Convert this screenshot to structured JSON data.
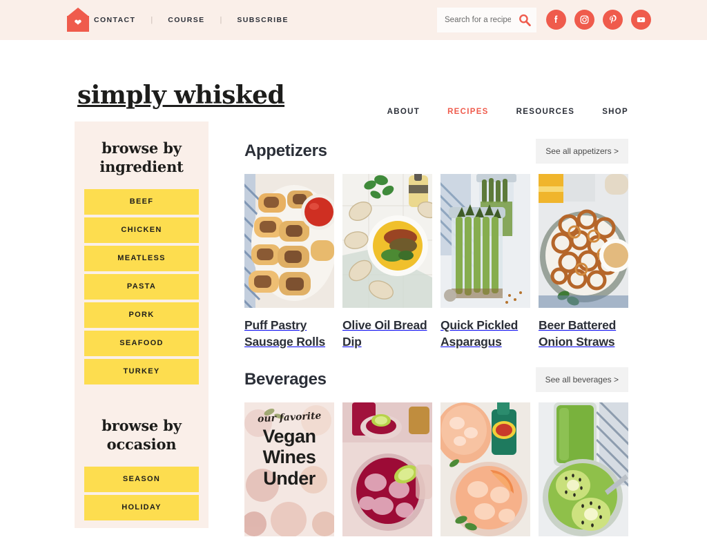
{
  "topbar": {
    "logo_icon": "house-heart-icon",
    "links": [
      {
        "label": "CONTACT"
      },
      {
        "label": "COURSE"
      },
      {
        "label": "SUBSCRIBE"
      }
    ],
    "separator": "|",
    "search": {
      "placeholder": "Search for a recipe",
      "value": "",
      "icon": "search-icon"
    },
    "socials": [
      {
        "name": "facebook-icon",
        "glyph": "f"
      },
      {
        "name": "instagram-icon",
        "glyph": ""
      },
      {
        "name": "pinterest-icon",
        "glyph": "P"
      },
      {
        "name": "youtube-icon",
        "glyph": ""
      }
    ]
  },
  "header": {
    "logo_text": "simply whisked",
    "nav": [
      {
        "label": "ABOUT",
        "active": false
      },
      {
        "label": "RECIPES",
        "active": true
      },
      {
        "label": "RESOURCES",
        "active": false
      },
      {
        "label": "SHOP",
        "active": false
      }
    ]
  },
  "sidebar": {
    "groups": [
      {
        "heading": "browse by ingredient",
        "items": [
          {
            "label": "BEEF"
          },
          {
            "label": "CHICKEN"
          },
          {
            "label": "MEATLESS"
          },
          {
            "label": "PASTA"
          },
          {
            "label": "PORK"
          },
          {
            "label": "SEAFOOD"
          },
          {
            "label": "TURKEY"
          }
        ]
      },
      {
        "heading": "browse by occasion",
        "items": [
          {
            "label": "SEASON"
          },
          {
            "label": "HOLIDAY"
          }
        ]
      }
    ]
  },
  "main": {
    "sections": [
      {
        "title": "Appetizers",
        "see_all_label": "See all appetizers >",
        "cards": [
          {
            "title": "Puff Pastry Sausage Rolls",
            "image_alt": "sausage-rolls-photo"
          },
          {
            "title": "Olive Oil Bread Dip",
            "image_alt": "olive-oil-bread-dip-photo"
          },
          {
            "title": "Quick Pickled Asparagus",
            "image_alt": "pickled-asparagus-photo"
          },
          {
            "title": "Beer Battered Onion Straws",
            "image_alt": "onion-straws-photo"
          }
        ]
      },
      {
        "title": "Beverages",
        "see_all_label": "See all beverages >",
        "cards": [
          {
            "title": "",
            "image_alt": "vegan-wines-pin",
            "overlay_script": "our favorite",
            "overlay_title": "Vegan Wines Under"
          },
          {
            "title": "",
            "image_alt": "cranberry-cocktail-photo"
          },
          {
            "title": "",
            "image_alt": "grapefruit-paloma-photo"
          },
          {
            "title": "",
            "image_alt": "kiwi-green-smoothie-photo"
          }
        ]
      }
    ]
  },
  "colors": {
    "accent_coral": "#ef5b4c",
    "accent_yellow": "#fddd4f",
    "bar_cream": "#faefe9",
    "text_dark": "#2b2f38",
    "see_all_bg": "#f2f2f2"
  }
}
